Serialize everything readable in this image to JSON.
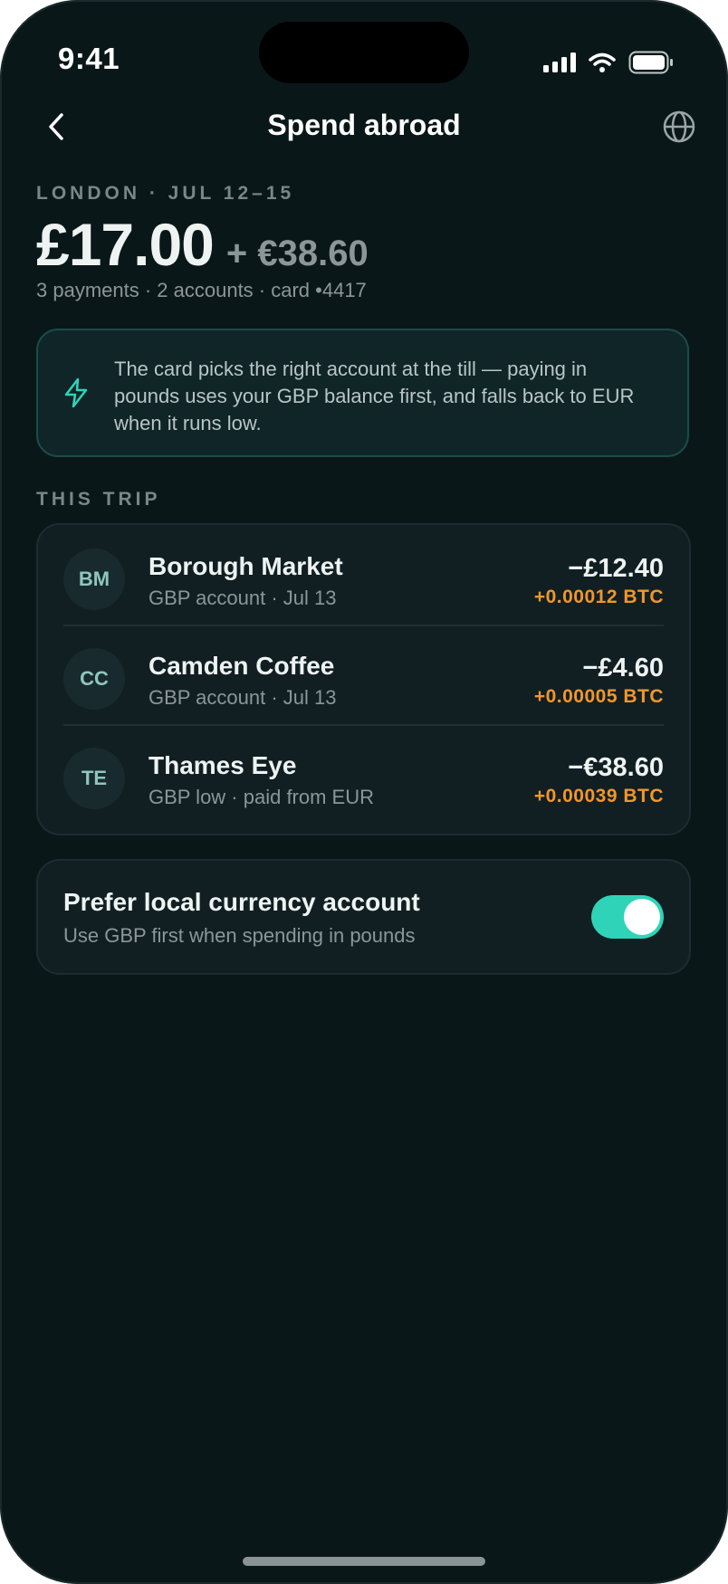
{
  "status_bar": {
    "time": "9:41",
    "icons": [
      "signal-icon",
      "wifi-icon",
      "battery-icon"
    ]
  },
  "nav": {
    "title": "Spend abroad",
    "back_icon": "chevron-left-icon",
    "globe_icon": "globe-icon"
  },
  "trip": {
    "location_dates": "LONDON · JUL 12–15",
    "total_gbp": "£17.00",
    "total_eur": "+ €38.60",
    "meta": "3 payments · 2 accounts · card •4417"
  },
  "info": {
    "icon": "lightning-icon",
    "text": "The card picks the right account at the till — paying in pounds uses your GBP balance first, and falls back to EUR when it runs low."
  },
  "section": {
    "label": "THIS TRIP"
  },
  "transactions": [
    {
      "initials": "BM",
      "merchant": "Borough Market",
      "detail": "GBP account · Jul 13",
      "amount": "−£12.40",
      "reward": "+0.00012 BTC"
    },
    {
      "initials": "CC",
      "merchant": "Camden Coffee",
      "detail": "GBP account · Jul 13",
      "amount": "−£4.60",
      "reward": "+0.00005 BTC"
    },
    {
      "initials": "TE",
      "merchant": "Thames Eye",
      "detail": "GBP low · paid from EUR",
      "amount": "−€38.60",
      "reward": "+0.00039 BTC"
    }
  ],
  "preference": {
    "title": "Prefer local currency account",
    "subtitle": "Use GBP first when spending in pounds",
    "enabled": true
  },
  "colors": {
    "background": "#0a1719",
    "accent": "#2fd4b8",
    "reward": "#f3962a",
    "card": "#111f23"
  }
}
